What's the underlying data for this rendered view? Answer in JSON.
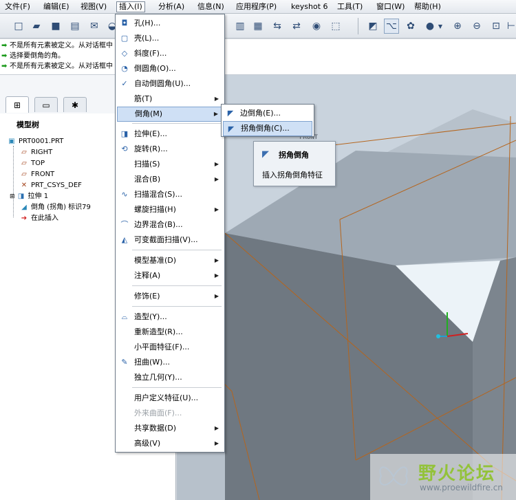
{
  "menubar": {
    "items": [
      {
        "label": "文件(F)"
      },
      {
        "label": "编辑(E)"
      },
      {
        "label": "视图(V)"
      },
      {
        "label": "插入(I)"
      },
      {
        "label": "分析(A)"
      },
      {
        "label": "信息(N)"
      },
      {
        "label": "应用程序(P)"
      },
      {
        "label": "keyshot 6"
      },
      {
        "label": "工具(T)"
      },
      {
        "label": "窗口(W)"
      },
      {
        "label": "帮助(H)"
      }
    ]
  },
  "messages": [
    "不是所有元素被定义。从对话框中",
    "选择要倒角的角。",
    "不是所有元素被定义。从对话框中"
  ],
  "model_tree": {
    "title": "模型树",
    "items": [
      {
        "label": "PRT0001.PRT",
        "icon": "part-icon"
      },
      {
        "label": "RIGHT",
        "icon": "datum-plane-icon"
      },
      {
        "label": "TOP",
        "icon": "datum-plane-icon"
      },
      {
        "label": "FRONT",
        "icon": "datum-plane-icon"
      },
      {
        "label": "PRT_CSYS_DEF",
        "icon": "csys-icon"
      },
      {
        "label": "拉伸 1",
        "icon": "extrude-icon"
      },
      {
        "label": "倒角 (拐角) 标识79",
        "icon": "chamfer-icon"
      },
      {
        "label": "在此插入",
        "icon": "insert-here-icon"
      }
    ]
  },
  "insert_menu": {
    "items": [
      {
        "label": "孔(H)...",
        "icon": "hole-icon",
        "submenu": false
      },
      {
        "label": "壳(L)...",
        "icon": "shell-icon",
        "submenu": false
      },
      {
        "label": "斜度(F)...",
        "icon": "draft-icon",
        "submenu": false
      },
      {
        "label": "倒圆角(O)...",
        "icon": "round-icon",
        "submenu": false
      },
      {
        "label": "自动倒圆角(U)...",
        "icon": "auto-round-icon",
        "submenu": false
      },
      {
        "label": "筋(T)",
        "icon": "",
        "submenu": true
      },
      {
        "label": "倒角(M)",
        "icon": "",
        "submenu": true
      },
      {
        "label": "拉伸(E)...",
        "icon": "extrude-icon",
        "submenu": false
      },
      {
        "label": "旋转(R)...",
        "icon": "revolve-icon",
        "submenu": false
      },
      {
        "label": "扫描(S)",
        "icon": "",
        "submenu": true
      },
      {
        "label": "混合(B)",
        "icon": "",
        "submenu": true
      },
      {
        "label": "扫描混合(S)...",
        "icon": "swept-blend-icon",
        "submenu": false
      },
      {
        "label": "螺旋扫描(H)",
        "icon": "",
        "submenu": true
      },
      {
        "label": "边界混合(B)...",
        "icon": "boundary-blend-icon",
        "submenu": false
      },
      {
        "label": "可变截面扫描(V)...",
        "icon": "var-sweep-icon",
        "submenu": false
      },
      {
        "label": "模型基准(D)",
        "icon": "",
        "submenu": true
      },
      {
        "label": "注释(A)",
        "icon": "",
        "submenu": true
      },
      {
        "label": "修饰(E)",
        "icon": "",
        "submenu": true
      },
      {
        "label": "造型(Y)...",
        "icon": "style-icon",
        "submenu": false
      },
      {
        "label": "重新造型(R)...",
        "icon": "",
        "submenu": false
      },
      {
        "label": "小平面特征(F)...",
        "icon": "",
        "submenu": false
      },
      {
        "label": "扭曲(W)...",
        "icon": "warp-icon",
        "submenu": false
      },
      {
        "label": "独立几何(Y)...",
        "icon": "",
        "submenu": false
      },
      {
        "label": "用户定义特征(U)...",
        "icon": "",
        "submenu": false
      },
      {
        "label": "外来曲面(F)...",
        "icon": "",
        "submenu": false,
        "disabled": true
      },
      {
        "label": "共享数据(D)",
        "icon": "",
        "submenu": true
      },
      {
        "label": "高级(V)",
        "icon": "",
        "submenu": true
      }
    ]
  },
  "chamfer_submenu": {
    "items": [
      {
        "label": "边倒角(E)...",
        "icon": "edge-chamfer-icon"
      },
      {
        "label": "拐角倒角(C)...",
        "icon": "corner-chamfer-icon"
      }
    ]
  },
  "tooltip": {
    "title": "拐角倒角",
    "description": "插入拐角倒角特征"
  },
  "viewport": {
    "datum_label": "FRONT",
    "colors": {
      "background": "#c9d3dd",
      "face_light": "#9aa5b1",
      "face_dark": "#6e7780",
      "datum_edge": "#b5651d"
    }
  },
  "watermark": {
    "text": "野火论坛",
    "url": "www.proewildfire.cn"
  }
}
